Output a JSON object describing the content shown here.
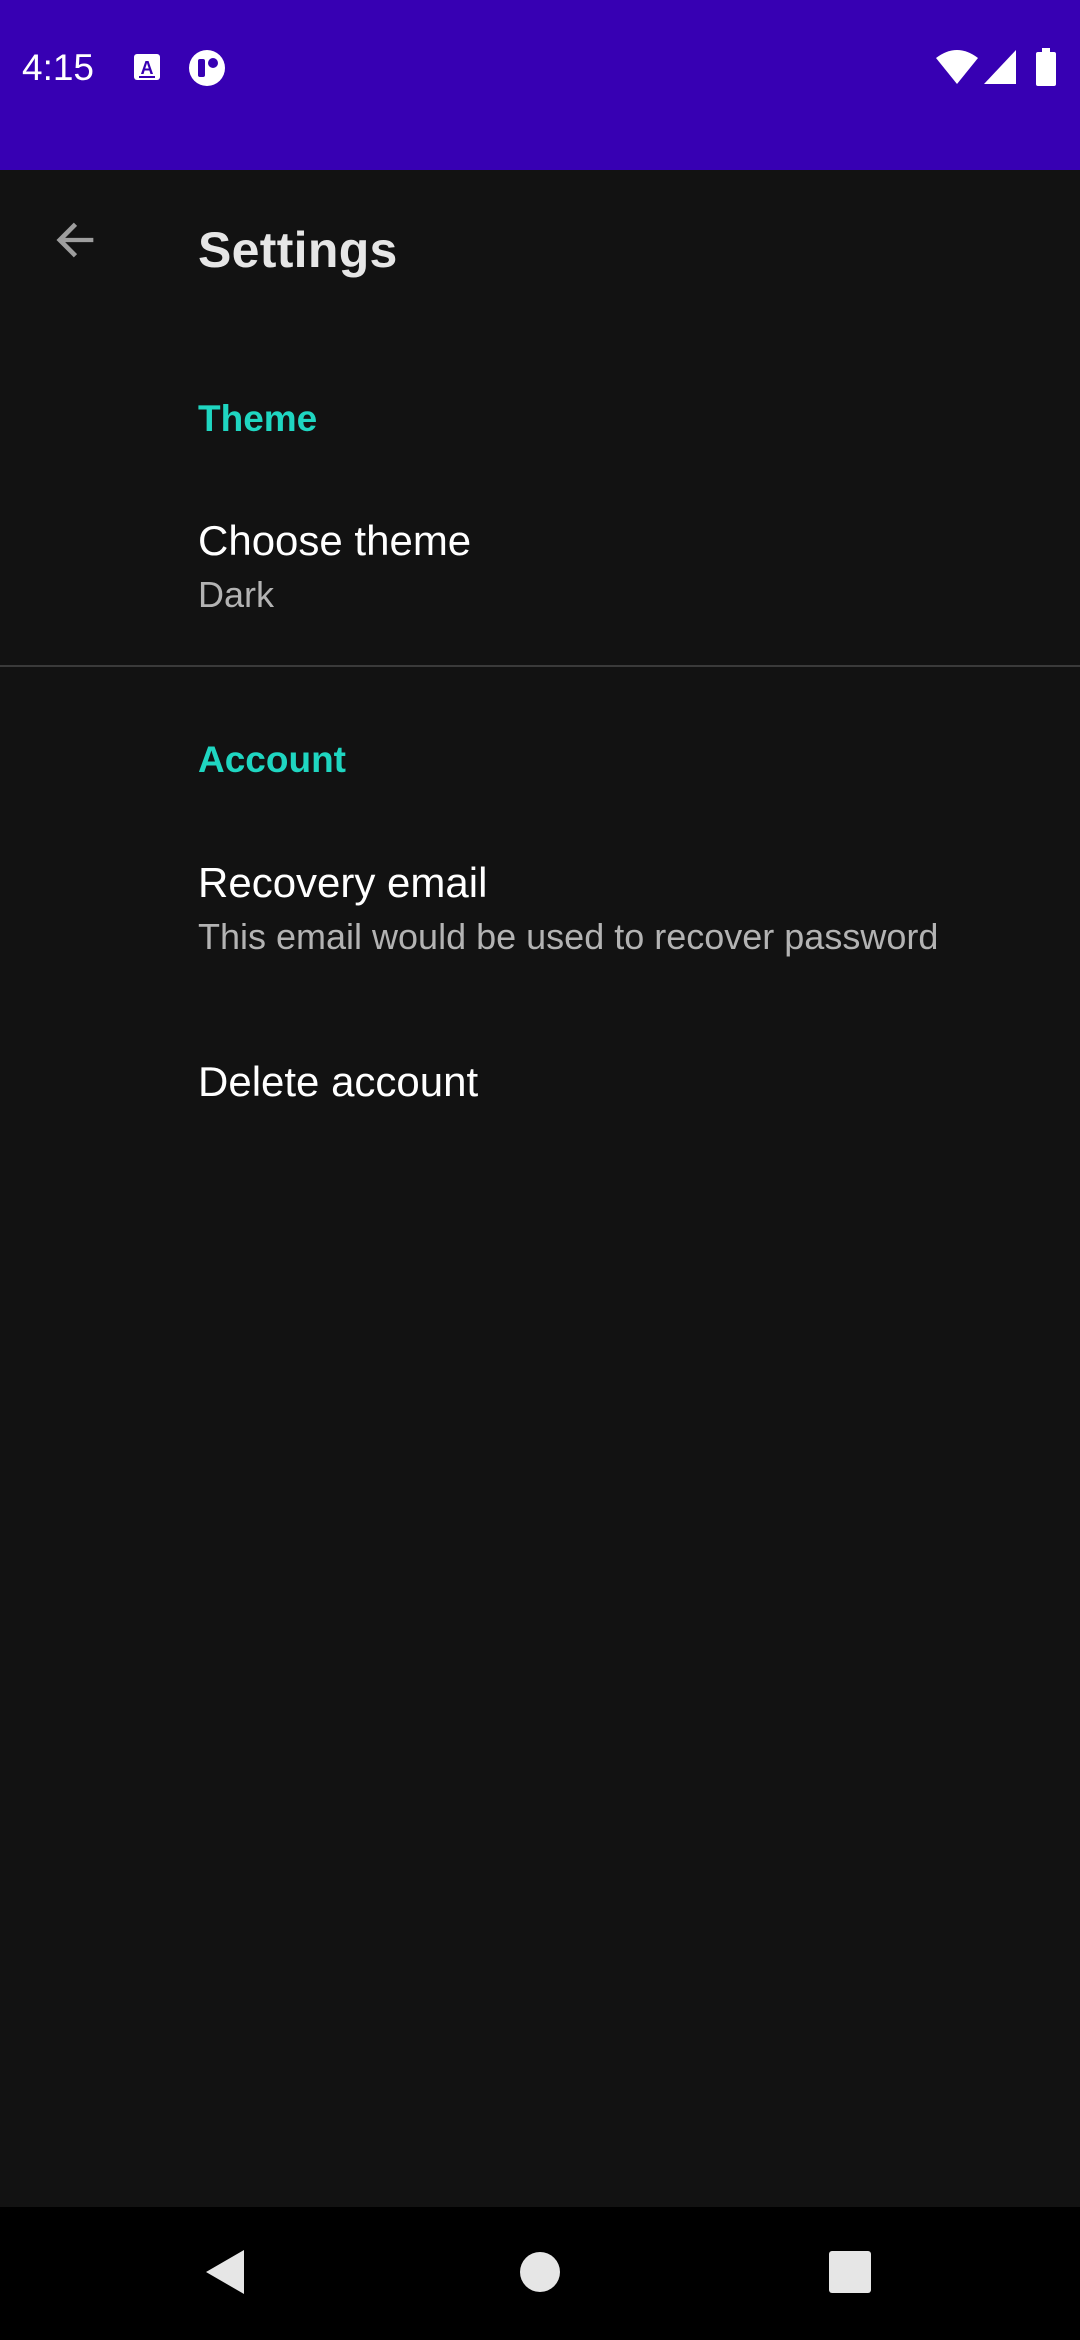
{
  "status_bar": {
    "time": "4:15",
    "background_color": "#3700b3",
    "icons_left": [
      "keyboard-a-icon",
      "app-notification-icon"
    ],
    "icons_right": [
      "wifi-icon",
      "cellular-signal-icon",
      "battery-icon"
    ]
  },
  "app_bar": {
    "title": "Settings",
    "back_icon": "arrow-back-icon"
  },
  "sections": [
    {
      "title": "Theme",
      "items": [
        {
          "title": "Choose theme",
          "summary": "Dark"
        }
      ]
    },
    {
      "title": "Account",
      "items": [
        {
          "title": "Recovery email",
          "summary": "This email would be used to recover password"
        },
        {
          "title": "Delete account"
        }
      ]
    }
  ],
  "nav_bar": {
    "buttons": [
      "back-triangle-icon",
      "home-circle-icon",
      "recents-square-icon"
    ]
  },
  "colors": {
    "accent": "#1fd6c1",
    "background": "#121212",
    "primary_dark": "#3700b3"
  }
}
